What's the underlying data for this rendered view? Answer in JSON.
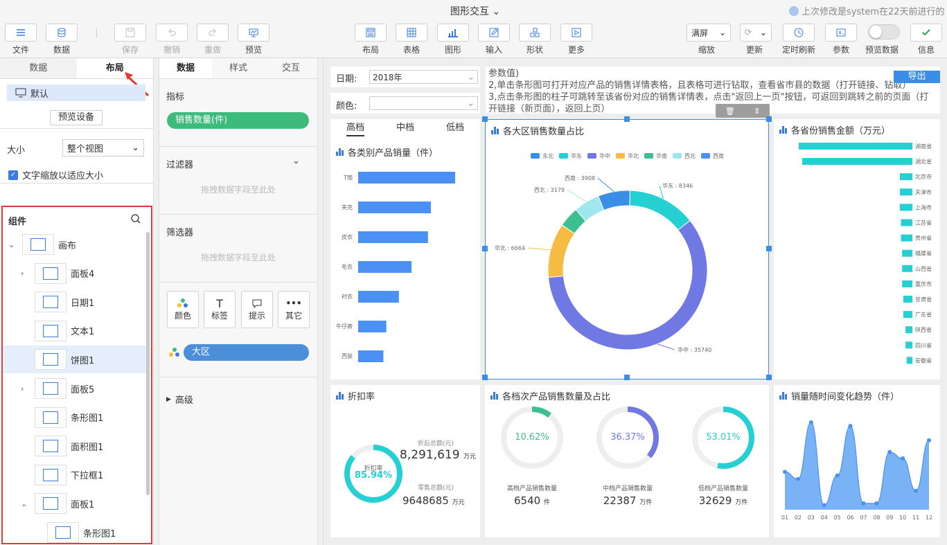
{
  "app": {
    "title": "图形交互",
    "last_modified": "上次修改是system在22天前进行的"
  },
  "toolbar": {
    "left": [
      {
        "id": "file",
        "label": "文件"
      },
      {
        "id": "data",
        "label": "数据"
      },
      {
        "id": "save",
        "label": "保存"
      },
      {
        "id": "undo",
        "label": "撤销"
      },
      {
        "id": "redo",
        "label": "重做"
      },
      {
        "id": "preview",
        "label": "预览"
      }
    ],
    "center": [
      {
        "id": "layout",
        "label": "布局"
      },
      {
        "id": "table",
        "label": "表格"
      },
      {
        "id": "chart",
        "label": "图形"
      },
      {
        "id": "input",
        "label": "输入"
      },
      {
        "id": "shape",
        "label": "形状"
      },
      {
        "id": "more",
        "label": "更多"
      }
    ],
    "zoom_value": "满屏",
    "zoom_label": "缩放",
    "refresh_label": "更新",
    "timed_refresh_label": "定时刷新",
    "param_label": "参数",
    "preview_data_label": "预览数据",
    "info_label": "信息"
  },
  "left": {
    "tabs": [
      "数据",
      "布局"
    ],
    "default_label": "默认",
    "preview_device": "预览设备",
    "size_label": "大小",
    "size_value": "整个视图",
    "text_scale_label": "文字缩放以适应大小",
    "components_label": "组件",
    "tree": [
      {
        "label": "画布",
        "level": 0,
        "exp": "v"
      },
      {
        "label": "面板4",
        "level": 1,
        "exp": ">"
      },
      {
        "label": "日期1",
        "level": 1,
        "exp": ""
      },
      {
        "label": "文本1",
        "level": 1,
        "exp": ""
      },
      {
        "label": "饼图1",
        "level": 1,
        "exp": "",
        "sel": true
      },
      {
        "label": "面板5",
        "level": 1,
        "exp": ">"
      },
      {
        "label": "条形图1",
        "level": 1,
        "exp": ""
      },
      {
        "label": "面积图1",
        "level": 1,
        "exp": ""
      },
      {
        "label": "下拉框1",
        "level": 1,
        "exp": ""
      },
      {
        "label": "面板1",
        "level": 1,
        "exp": "v"
      },
      {
        "label": "条形图1",
        "level": 2,
        "exp": ""
      }
    ]
  },
  "middle": {
    "tabs": [
      "数据",
      "样式",
      "交互"
    ],
    "metric_label": "指标",
    "metric_value": "销售数量(件)",
    "filter_label": "过滤器",
    "drop_hint": "拖拽数据字段至此处",
    "selector_label": "筛选器",
    "mark_buttons": [
      "颜色",
      "标签",
      "提示",
      "其它"
    ],
    "dimension_value": "大区",
    "advanced_label": "高级"
  },
  "canvas": {
    "date_label": "日期:",
    "date_value": "2018年",
    "color_label": "颜色:",
    "param_text": [
      "参数值)",
      "2,单击条形图可打开对应产品的销售详情表格，且表格可进行钻取，查看省市县的数据（打开链接、钻取）",
      "3,点击条形图的柱子可跳转至该省份对应的销售详情表，点击\"返回上一页\"按钮，可返回到跳转之前的页面（打",
      "开链接（新页面），返回上页）"
    ],
    "export_label": "导出",
    "grade_tabs": [
      "高档",
      "中档",
      "低档"
    ],
    "bar1_title": "各类别产品销量（件）",
    "pie_title": "各大区销售数量占比",
    "prov_title": "各省份销售金额（万元）",
    "discount_title": "折扣率",
    "grade_title": "各档次产品销售数量及占比",
    "trend_title": "销量随时间变化趋势（件）",
    "discount": {
      "inner_label": "折扣率",
      "pct": "85.94%",
      "pct_value": 85.94,
      "after_label": "折后总额(元)",
      "after_value": "8,291,619",
      "after_unit": "万元",
      "retail_label": "零售总额(元)",
      "retail_value": "9648685",
      "retail_unit": "万元"
    },
    "grades": [
      {
        "pct": "10.62%",
        "value": 10.62,
        "color": "#3dbf8f",
        "label": "高档产品销售数量",
        "num": "6540",
        "unit": "件"
      },
      {
        "pct": "36.37%",
        "value": 36.37,
        "color": "#6f78e3",
        "label": "中档产品销售数量",
        "num": "22387",
        "unit": "万件"
      },
      {
        "pct": "53.01%",
        "value": 53.01,
        "color": "#25d0d3",
        "label": "低档产品销售数量",
        "num": "32629",
        "unit": "万件"
      }
    ]
  },
  "chart_data": [
    {
      "type": "bar",
      "title": "各类别产品销量（件）",
      "categories": [
        "T恤",
        "夹克",
        "皮衣",
        "毛衣",
        "衬衣",
        "牛仔裤",
        "西装"
      ],
      "values": [
        100,
        75,
        72,
        55,
        42,
        29,
        26
      ],
      "color": "#4a90f5"
    },
    {
      "type": "pie",
      "title": "各大区销售数量占比",
      "legend": [
        "东北",
        "华东",
        "华中",
        "华北",
        "华南",
        "西北",
        "西南"
      ],
      "legend_position": "top",
      "colors": [
        "#3a8ee6",
        "#25d0d3",
        "#6f78e3",
        "#f6bb42",
        "#3dbf8f",
        "#9fe6ee",
        "#4a90f5"
      ],
      "slices": [
        {
          "name": "华东",
          "value": 8346,
          "label": "华东 : 8346",
          "color": "#25d0d3"
        },
        {
          "name": "华中",
          "value": 35740,
          "label": "华中 : 35740",
          "color": "#6f78e3"
        },
        {
          "name": "华北",
          "value": 6664,
          "label": "华北 : 6664",
          "color": "#f6bb42"
        },
        {
          "name": "华南",
          "value": 2500,
          "label": "",
          "color": "#3dbf8f"
        },
        {
          "name": "西北",
          "value": 3179,
          "label": "西北 : 3179",
          "color": "#9fe6ee"
        },
        {
          "name": "西南",
          "value": 3908,
          "label": "西南 : 3908",
          "color": "#3a8ee6"
        }
      ]
    },
    {
      "type": "bar",
      "title": "各省份销售金额（万元）",
      "categories": [
        "湖南省",
        "湖北省",
        "北京市",
        "天津市",
        "上海市",
        "江苏省",
        "贵州省",
        "福建省",
        "山西省",
        "重庆市",
        "甘肃省",
        "广东省",
        "陕西省",
        "四川省",
        "安徽省"
      ],
      "values": [
        100,
        97,
        11,
        11,
        11,
        10,
        10,
        9,
        9,
        9,
        8,
        8,
        6,
        6,
        5
      ],
      "color": "#25d0d3"
    },
    {
      "type": "area",
      "title": "销量随时间变化趋势（件）",
      "x": [
        "01",
        "02",
        "03",
        "04",
        "05",
        "06",
        "07",
        "08",
        "09",
        "10",
        "11",
        "12"
      ],
      "values": [
        42,
        34,
        97,
        5,
        38,
        93,
        7,
        7,
        64,
        57,
        21,
        77
      ],
      "color": "#4a90f5"
    }
  ]
}
